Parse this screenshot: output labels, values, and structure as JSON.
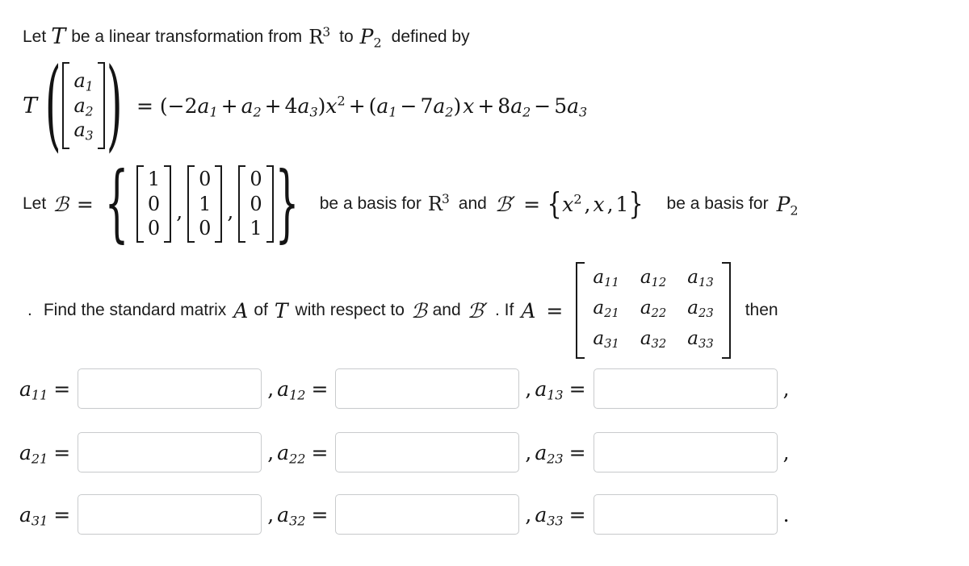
{
  "problem": {
    "intro": {
      "prefix": "Let",
      "t_symbol": "T",
      "middle": "be a linear transformation from",
      "domain_space": "R",
      "domain_exp": "3",
      "to_word": "to",
      "codomain_space": "P",
      "codomain_sub": "2",
      "suffix": "defined by"
    },
    "transformation": {
      "t_symbol": "T",
      "input_vector": [
        "a1",
        "a2",
        "a3"
      ],
      "equals": "=",
      "formula_plain": "(-2a₁ + a₂ + 4a₃)x² + (a₁ - 7a₂)x + 8a₂ - 5a₃",
      "term1": {
        "open": "(",
        "c1_sign": "−",
        "c1_coef": "2",
        "c1_var": "a",
        "c1_sub": "1",
        "c2_sign": "+",
        "c2_coef": "",
        "c2_var": "a",
        "c2_sub": "2",
        "c3_sign": "+",
        "c3_coef": "4",
        "c3_var": "a",
        "c3_sub": "3",
        "close": ")",
        "basis_var": "x",
        "basis_exp": "2"
      },
      "join1": "+",
      "term2": {
        "open": "(",
        "c1_sign": "",
        "c1_coef": "",
        "c1_var": "a",
        "c1_sub": "1",
        "c2_sign": "−",
        "c2_coef": "7",
        "c2_var": "a",
        "c2_sub": "2",
        "close": ")",
        "basis_var": "x"
      },
      "join2": "+",
      "term3": {
        "c1_coef": "8",
        "c1_var": "a",
        "c1_sub": "2",
        "c2_sign": "−",
        "c2_coef": "5",
        "c2_var": "a",
        "c2_sub": "3"
      }
    },
    "basis_line": {
      "let_word": "Let",
      "b_symbol": "ℬ",
      "equals": "=",
      "vectors": [
        [
          "1",
          "0",
          "0"
        ],
        [
          "0",
          "1",
          "0"
        ],
        [
          "0",
          "0",
          "1"
        ]
      ],
      "separator": ",",
      "mid_text_1": "be a basis for",
      "space1": "R",
      "space1_exp": "3",
      "and_word": "and",
      "bprime_symbol": "ℬ′",
      "equals2": "=",
      "poly_basis": [
        "x²",
        "x",
        "1"
      ],
      "poly_basis_items": [
        {
          "var": "x",
          "exp": "2"
        },
        {
          "var": "x",
          "exp": ""
        },
        {
          "var": "1",
          "exp": ""
        }
      ],
      "mid_text_2": "be a basis for",
      "space2": "P",
      "space2_sub": "2"
    },
    "question_line": {
      "lead_punct": ".",
      "text_1": "Find the standard matrix",
      "a_symbol": "A",
      "of_word": "of",
      "t_symbol": "T",
      "text_2": "with respect to",
      "b_symbol": "ℬ",
      "and_word": "and",
      "bprime_symbol": "ℬ′",
      "text_3": ". If",
      "a_symbol_2": "A",
      "equals": "=",
      "matrix_entries": [
        [
          "a11",
          "a12",
          "a13"
        ],
        [
          "a21",
          "a22",
          "a23"
        ],
        [
          "a31",
          "a32",
          "a33"
        ]
      ],
      "matrix_entries_parts": [
        [
          {
            "v": "a",
            "s": "11"
          },
          {
            "v": "a",
            "s": "12"
          },
          {
            "v": "a",
            "s": "13"
          }
        ],
        [
          {
            "v": "a",
            "s": "21"
          },
          {
            "v": "a",
            "s": "22"
          },
          {
            "v": "a",
            "s": "23"
          }
        ],
        [
          {
            "v": "a",
            "s": "31"
          },
          {
            "v": "a",
            "s": "32"
          },
          {
            "v": "a",
            "s": "33"
          }
        ]
      ],
      "then_word": "then"
    }
  },
  "answers": {
    "rows": [
      {
        "cells": [
          {
            "label_var": "a",
            "label_sub": "11",
            "equals": "=",
            "value": "",
            "placeholder": "",
            "trailing": ","
          },
          {
            "label_var": "a",
            "label_sub": "12",
            "equals": "=",
            "value": "",
            "placeholder": "",
            "trailing": ","
          },
          {
            "label_var": "a",
            "label_sub": "13",
            "equals": "=",
            "value": "",
            "placeholder": "",
            "trailing": ","
          }
        ]
      },
      {
        "cells": [
          {
            "label_var": "a",
            "label_sub": "21",
            "equals": "=",
            "value": "",
            "placeholder": "",
            "trailing": ","
          },
          {
            "label_var": "a",
            "label_sub": "22",
            "equals": "=",
            "value": "",
            "placeholder": "",
            "trailing": ","
          },
          {
            "label_var": "a",
            "label_sub": "23",
            "equals": "=",
            "value": "",
            "placeholder": "",
            "trailing": ","
          }
        ]
      },
      {
        "cells": [
          {
            "label_var": "a",
            "label_sub": "31",
            "equals": "=",
            "value": "",
            "placeholder": "",
            "trailing": ","
          },
          {
            "label_var": "a",
            "label_sub": "32",
            "equals": "=",
            "value": "",
            "placeholder": "",
            "trailing": ","
          },
          {
            "label_var": "a",
            "label_sub": "33",
            "equals": "=",
            "value": "",
            "placeholder": "",
            "trailing": "."
          }
        ]
      }
    ]
  },
  "colors": {
    "text": "#141414",
    "field_border": "#c9cbcd",
    "background": "#ffffff"
  }
}
